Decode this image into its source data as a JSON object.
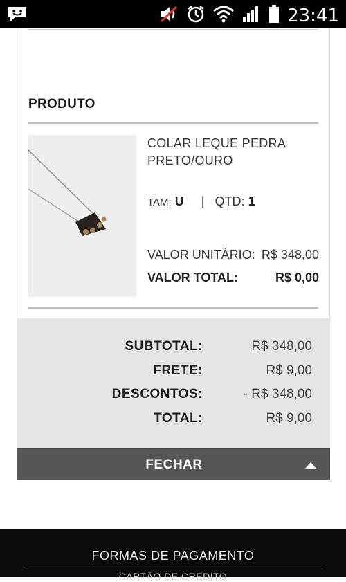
{
  "status_bar": {
    "time": "23:41",
    "icons": [
      "message-icon",
      "mute-icon",
      "alarm-icon",
      "wifi-icon",
      "signal-icon",
      "battery-icon"
    ]
  },
  "section": {
    "title": "PRODUTO"
  },
  "product": {
    "name_line1": "COLAR LEQUE PEDRA",
    "name_line2": "PRETO/OURO",
    "size_label": "TAM:",
    "size_value": "U",
    "separator": "|",
    "qty_label": "QTD:",
    "qty_value": "1",
    "unit_label": "VALOR UNITÁRIO:",
    "unit_value": "R$ 348,00",
    "total_label": "VALOR TOTAL:",
    "total_value": "R$ 0,00"
  },
  "summary": {
    "subtotal_label": "SUBTOTAL:",
    "subtotal_value": "R$ 348,00",
    "shipping_label": "FRETE:",
    "shipping_value": "R$ 9,00",
    "discount_label": "DESCONTOS:",
    "discount_value": "- R$ 348,00",
    "total_label": "TOTAL:",
    "total_value": "R$ 9,00"
  },
  "close_button": {
    "label": "FECHAR"
  },
  "footer": {
    "title": "FORMAS DE PAGAMENTO",
    "subtitle": "CARTÃO DE CRÉDITO"
  },
  "colors": {
    "summary_bg": "#e5e5e5",
    "close_bar_bg": "#555555",
    "footer_bg": "#0a0a0a"
  }
}
